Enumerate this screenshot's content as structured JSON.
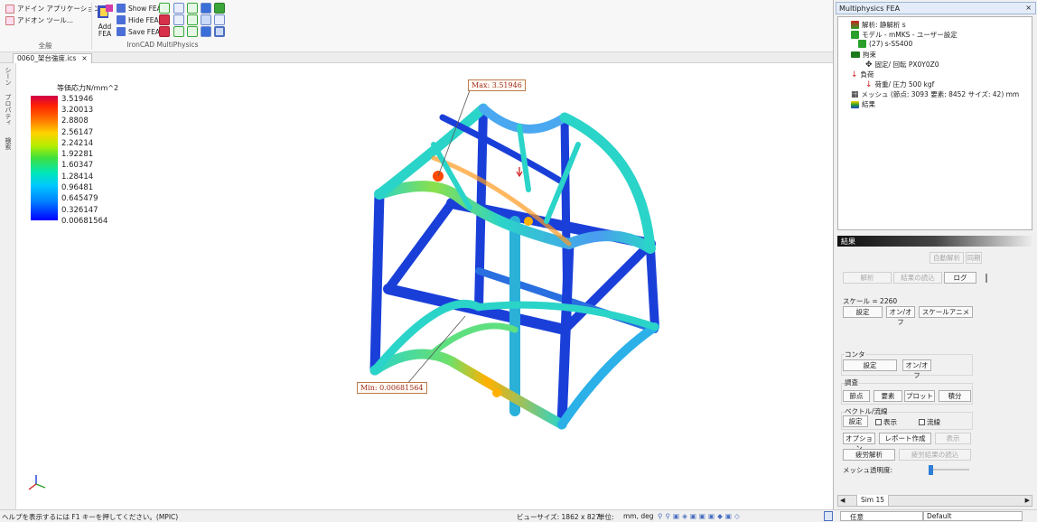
{
  "ribbon": {
    "general_group": {
      "items": [
        "アドイン アプリケーション...",
        "アドオン ツール..."
      ],
      "label": "全般"
    },
    "fea_group": {
      "add_fea_line1": "Add",
      "add_fea_line2": "FEA",
      "show_fea": "Show FEA",
      "hide_fea": "Hide FEA",
      "save_fea": "Save FEA",
      "label": "IronCAD MultiPhysics"
    }
  },
  "document_tab": {
    "title": "0060_架台強度.ics",
    "close": "×"
  },
  "side_strip": {
    "items": [
      "シーン",
      "プロパティ",
      "検索"
    ]
  },
  "legend": {
    "title": "等価応力N/mm^2",
    "values": [
      "3.51946",
      "3.20013",
      "2.8808",
      "2.56147",
      "2.24214",
      "1.92281",
      "1.60347",
      "1.28414",
      "0.96481",
      "0.645479",
      "0.326147",
      "0.00681564"
    ]
  },
  "callouts": {
    "max": "Max: 3.51946",
    "min": "Min: 0.00681564"
  },
  "status_bar": {
    "help": "ヘルプを表示するには F1 キーを押してください。(MPIC)",
    "view_size": "ビューサイズ: 1862 x  827",
    "units_label": "単位:",
    "units": "mm, deg",
    "mode_select": "任意",
    "style_select": "Default"
  },
  "panel": {
    "title": "Multiphysics FEA",
    "close": "×",
    "tree": [
      "解析: 静解析 s",
      "モデル - mMKS - ユーザー設定",
      "(27)  s-SS400",
      "拘束",
      "固定/ 回転 PX0Y0Z0",
      "負荷",
      "荷重/ 圧力 500 kgf",
      "メッシュ (節点: 3093   要素: 8452   サイズ: 42) mm",
      "結果"
    ],
    "results_header": "結果",
    "auto_analysis": "自動解析",
    "sync": "同期",
    "analyze": "解析",
    "read_results": "結果の読込",
    "log": "ログ",
    "scale_text": "スケール = 2260",
    "settings": "設定",
    "on_off": "オン/オフ",
    "scale_anim": "スケールアニメ",
    "contour_label": "コンタ",
    "survey_label": "調査",
    "node": "節点",
    "element": "要素",
    "plot": "プロット",
    "integral": "積分",
    "vector_label": "ベクトル/流線",
    "show_chk": "表示",
    "streamline_chk": "流線",
    "options": "オプション",
    "report": "レポート作成",
    "display": "表示",
    "fatigue": "疲労解析",
    "fatigue_read": "疲労結果の読込",
    "mesh_transparency": "メッシュ透明度:",
    "tab_sim": "Sim 15"
  },
  "colors": {
    "legend_high": "#d0004a",
    "legend_low": "#0000ff",
    "beam_blue": "#1a3fd9",
    "stress_mid": "#2bd4c8",
    "stress_high": "#ff4a00"
  }
}
